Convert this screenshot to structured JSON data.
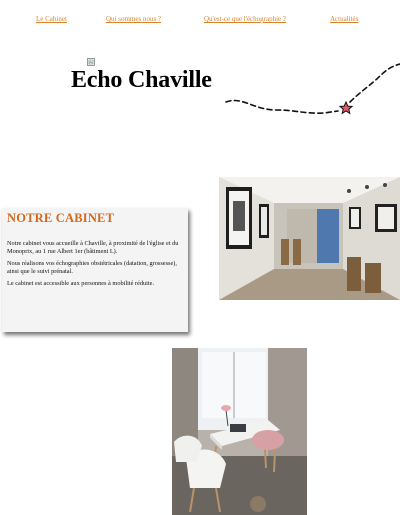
{
  "nav": {
    "items": [
      {
        "label": "Le Cabinet"
      },
      {
        "label": "Qui sommes nous ?"
      },
      {
        "label": "Qu'est-ce que l'échographie ?"
      },
      {
        "label": "Actualités"
      }
    ]
  },
  "header": {
    "logo_icon": "broken-image-icon",
    "title": "Echo Chaville"
  },
  "cabinet": {
    "heading": "NOTRE CABINET",
    "paragraphs": [
      "Notre cabinet vous accueille à Chaville, à proximité de l'église et du Monoprix, au 1 rue Albert 1er (bâtiment L).",
      "Nous réalisons vos échographies obstétricales (datation, grossesse), ainsi que le suivi prénatal.",
      "Le cabinet est accessible aux personnes à mobilité réduite."
    ]
  },
  "photos": [
    {
      "name": "corridor-photo",
      "icon": "photo"
    },
    {
      "name": "office-photo",
      "icon": "photo"
    }
  ],
  "colors": {
    "accent": "#d9822b",
    "heading": "#d2691e",
    "card_background": "#f4f4f4",
    "star": "#e05a6a"
  }
}
